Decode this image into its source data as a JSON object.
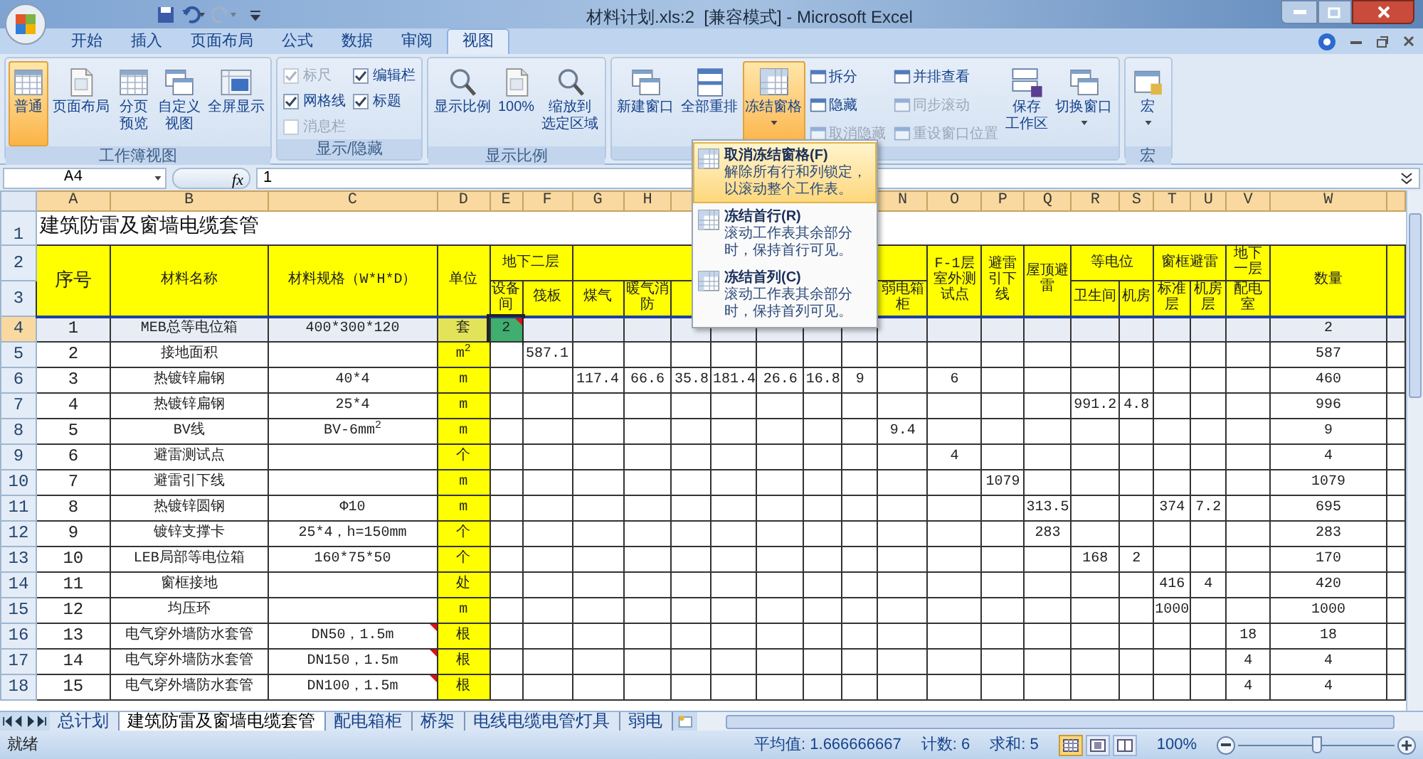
{
  "window": {
    "title": "材料计划.xls:2  [兼容模式] - Microsoft Excel"
  },
  "ribbon_tabs": [
    {
      "label": "开始",
      "selected": false
    },
    {
      "label": "插入",
      "selected": false
    },
    {
      "label": "页面布局",
      "selected": false
    },
    {
      "label": "公式",
      "selected": false
    },
    {
      "label": "数据",
      "selected": false
    },
    {
      "label": "审阅",
      "selected": false
    },
    {
      "label": "视图",
      "selected": true
    }
  ],
  "ribbon_groups": [
    {
      "label": "工作簿视图",
      "items": [
        {
          "kind": "large",
          "label": "普通",
          "selected": true
        },
        {
          "kind": "large",
          "label": "页面布局",
          "selected": false
        },
        {
          "kind": "large",
          "label_lines": [
            "分页",
            "预览"
          ],
          "selected": false
        },
        {
          "kind": "large",
          "label_lines": [
            "自定义",
            "视图"
          ],
          "selected": false
        },
        {
          "kind": "large",
          "label": "全屏显示",
          "selected": false
        }
      ]
    },
    {
      "label": "显示/隐藏",
      "items": [
        {
          "kind": "check",
          "label": "标尺",
          "checked": true,
          "disabled": true
        },
        {
          "kind": "check",
          "label": "网格线",
          "checked": true,
          "disabled": false
        },
        {
          "kind": "check",
          "label": "消息栏",
          "checked": false,
          "disabled": true
        },
        {
          "kind": "check",
          "label": "编辑栏",
          "checked": true,
          "disabled": false
        },
        {
          "kind": "check",
          "label": "标题",
          "checked": true,
          "disabled": false
        }
      ]
    },
    {
      "label": "显示比例",
      "items": [
        {
          "kind": "large",
          "label": "显示比例",
          "selected": false
        },
        {
          "kind": "large",
          "label": "100%",
          "selected": false
        },
        {
          "kind": "large",
          "label_lines": [
            "缩放到",
            "选定区域"
          ],
          "selected": false
        }
      ]
    },
    {
      "items": [
        {
          "kind": "large",
          "label": "新建窗口",
          "selected": false
        },
        {
          "kind": "large",
          "label": "全部重排",
          "selected": false
        },
        {
          "kind": "large",
          "label": "冻结窗格",
          "selected": true,
          "dropdown": true
        },
        {
          "kind": "small",
          "label": "拆分",
          "disabled": false
        },
        {
          "kind": "small",
          "label": "隐藏",
          "disabled": false
        },
        {
          "kind": "small",
          "label": "取消隐藏",
          "disabled": true
        },
        {
          "kind": "small",
          "label": "并排查看",
          "disabled": false
        },
        {
          "kind": "small",
          "label": "同步滚动",
          "disabled": true
        },
        {
          "kind": "small",
          "label": "重设窗口位置",
          "disabled": true
        },
        {
          "kind": "large",
          "label_lines": [
            "保存",
            "工作区"
          ],
          "selected": false
        },
        {
          "kind": "large",
          "label": "切换窗口",
          "selected": false,
          "dropdown": true
        }
      ]
    },
    {
      "label": "宏",
      "items": [
        {
          "kind": "large",
          "label": "宏",
          "selected": false,
          "dropdown": true
        }
      ]
    }
  ],
  "freeze_menu": {
    "items": [
      {
        "title": "取消冻结窗格(F)",
        "description": "解除所有行和列锁定，以滚动整个工作表。",
        "selected": true
      },
      {
        "title": "冻结首行(R)",
        "description": "滚动工作表其余部分时，保持首行可见。",
        "selected": false
      },
      {
        "title": "冻结首列(C)",
        "description": "滚动工作表其余部分时，保持首列可见。",
        "selected": false
      }
    ]
  },
  "formula_bar": {
    "name_box": "A4",
    "function_label": "fx",
    "value": "1"
  },
  "sheet": {
    "column_headers": [
      "A",
      "B",
      "C",
      "D",
      "E",
      "F",
      "G",
      "H",
      "N",
      "O",
      "P",
      "Q",
      "R",
      "S",
      "T",
      "U",
      "V",
      "W"
    ],
    "title_row": {
      "number": "1",
      "text": "建筑防雷及窗墙电缆套管"
    },
    "header_row_numbers": [
      "2",
      "3"
    ],
    "header_columns": [
      {
        "text": "序号"
      },
      {
        "text": "材料名称"
      },
      {
        "text": "材料规格（W*H*D）"
      },
      {
        "text": "单位"
      },
      {
        "group": "地下二层",
        "children": [
          "设备间",
          "筏板"
        ]
      },
      {
        "children": [
          "煤气",
          "暖气消防",
          "弱电箱柜"
        ]
      },
      {
        "text": "F-1层室外测试点"
      },
      {
        "text": "避雷引下线"
      },
      {
        "text": "屋顶避雷"
      },
      {
        "group": "等电位",
        "children": [
          "卫生间",
          "机房"
        ]
      },
      {
        "group": "窗框避雷",
        "children": [
          "标准层",
          "机房层"
        ]
      },
      {
        "group": "地下一层",
        "children": [
          "配电室"
        ]
      },
      {
        "text": "数量"
      }
    ],
    "rows": [
      {
        "number": "4",
        "selected": true,
        "cells": [
          "1",
          "MEB总等电位箱",
          "400*300*120",
          "套",
          {
            "text": "2",
            "active": true,
            "comment": true
          },
          null,
          null,
          null,
          null,
          null,
          null,
          null,
          null,
          null,
          null,
          null,
          null,
          null,
          null,
          null,
          null,
          null,
          "2"
        ]
      },
      {
        "number": "5",
        "selected": false,
        "cells": [
          "2",
          "接地面积",
          null,
          "m$^{2}$",
          null,
          "587.1",
          null,
          null,
          null,
          null,
          null,
          null,
          null,
          null,
          null,
          null,
          null,
          null,
          null,
          null,
          null,
          null,
          "587"
        ]
      },
      {
        "number": "6",
        "selected": false,
        "cells": [
          "3",
          "热镀锌扁钢",
          "40*4",
          "m",
          null,
          null,
          "117.4",
          "66.6",
          "35.8",
          "181.4",
          "26.6",
          "16.8",
          "9",
          null,
          "6",
          null,
          null,
          null,
          null,
          null,
          null,
          null,
          "460"
        ]
      },
      {
        "number": "7",
        "selected": false,
        "cells": [
          "4",
          "热镀锌扁钢",
          "25*4",
          "m",
          null,
          null,
          null,
          null,
          null,
          null,
          null,
          null,
          null,
          null,
          null,
          null,
          null,
          "991.2",
          "4.8",
          null,
          null,
          null,
          "996"
        ]
      },
      {
        "number": "8",
        "selected": false,
        "cells": [
          "5",
          "BV线",
          "BV-6mm$^{2}$",
          "m",
          null,
          null,
          null,
          null,
          null,
          null,
          null,
          null,
          null,
          "9.4",
          null,
          null,
          null,
          null,
          null,
          null,
          null,
          null,
          "9"
        ]
      },
      {
        "number": "9",
        "selected": false,
        "cells": [
          "6",
          "避雷测试点",
          null,
          "个",
          null,
          null,
          null,
          null,
          null,
          null,
          null,
          null,
          null,
          null,
          "4",
          null,
          null,
          null,
          null,
          null,
          null,
          null,
          "4"
        ]
      },
      {
        "number": "10",
        "selected": false,
        "cells": [
          "7",
          "避雷引下线",
          null,
          "m",
          null,
          null,
          null,
          null,
          null,
          null,
          null,
          null,
          null,
          null,
          null,
          "1079",
          null,
          null,
          null,
          null,
          null,
          null,
          "1079"
        ]
      },
      {
        "number": "11",
        "selected": false,
        "cells": [
          "8",
          "热镀锌圆钢",
          "Φ10",
          "m",
          null,
          null,
          null,
          null,
          null,
          null,
          null,
          null,
          null,
          null,
          null,
          null,
          "313.5",
          null,
          null,
          "374",
          "7.2",
          null,
          "695"
        ]
      },
      {
        "number": "12",
        "selected": false,
        "cells": [
          "9",
          "镀锌支撑卡",
          "25*4，h=150mm",
          "个",
          null,
          null,
          null,
          null,
          null,
          null,
          null,
          null,
          null,
          null,
          null,
          null,
          "283",
          null,
          null,
          null,
          null,
          null,
          "283"
        ]
      },
      {
        "number": "13",
        "selected": false,
        "cells": [
          "10",
          "LEB局部等电位箱",
          "160*75*50",
          "个",
          null,
          null,
          null,
          null,
          null,
          null,
          null,
          null,
          null,
          null,
          null,
          null,
          null,
          "168",
          "2",
          null,
          null,
          null,
          "170"
        ]
      },
      {
        "number": "14",
        "selected": false,
        "cells": [
          "11",
          "窗框接地",
          null,
          "处",
          null,
          null,
          null,
          null,
          null,
          null,
          null,
          null,
          null,
          null,
          null,
          null,
          null,
          null,
          null,
          "416",
          "4",
          null,
          "420"
        ]
      },
      {
        "number": "15",
        "selected": false,
        "cells": [
          "12",
          "均压环",
          null,
          "m",
          null,
          null,
          null,
          null,
          null,
          null,
          null,
          null,
          null,
          null,
          null,
          null,
          null,
          null,
          null,
          "1000",
          null,
          null,
          "1000"
        ]
      },
      {
        "number": "16",
        "selected": false,
        "cells": [
          "13",
          "电气穿外墙防水套管",
          {
            "text": "DN50，1.5m",
            "comment": true
          },
          "根",
          null,
          null,
          null,
          null,
          null,
          null,
          null,
          null,
          null,
          null,
          null,
          null,
          null,
          null,
          null,
          null,
          null,
          "18",
          "18"
        ]
      },
      {
        "number": "17",
        "selected": false,
        "cells": [
          "14",
          "电气穿外墙防水套管",
          {
            "text": "DN150，1.5m",
            "comment": true
          },
          "根",
          null,
          null,
          null,
          null,
          null,
          null,
          null,
          null,
          null,
          null,
          null,
          null,
          null,
          null,
          null,
          null,
          null,
          "4",
          "4"
        ]
      },
      {
        "number": "18",
        "selected": false,
        "cells": [
          "15",
          "电气穿外墙防水套管",
          {
            "text": "DN100，1.5m",
            "comment": true
          },
          "根",
          null,
          null,
          null,
          null,
          null,
          null,
          null,
          null,
          null,
          null,
          null,
          null,
          null,
          null,
          null,
          null,
          null,
          "4",
          "4"
        ]
      }
    ]
  },
  "sheet_tabs": [
    {
      "label": "总计划",
      "selected": false
    },
    {
      "label": "建筑防雷及窗墙电缆套管",
      "selected": true
    },
    {
      "label": "配电箱柜",
      "selected": false
    },
    {
      "label": "桥架",
      "selected": false
    },
    {
      "label": "电线电缆电管灯具",
      "selected": false
    },
    {
      "label": "弱电",
      "selected": false
    }
  ],
  "status_bar": {
    "status": "就绪",
    "average": "平均值: 1.666666667",
    "count": "计数: 6",
    "sum": "求和: 5",
    "view_buttons": [
      {
        "selected": true
      },
      {
        "selected": false
      },
      {
        "selected": false
      }
    ],
    "zoom": {
      "label": "100%",
      "level": 0.5
    }
  }
}
